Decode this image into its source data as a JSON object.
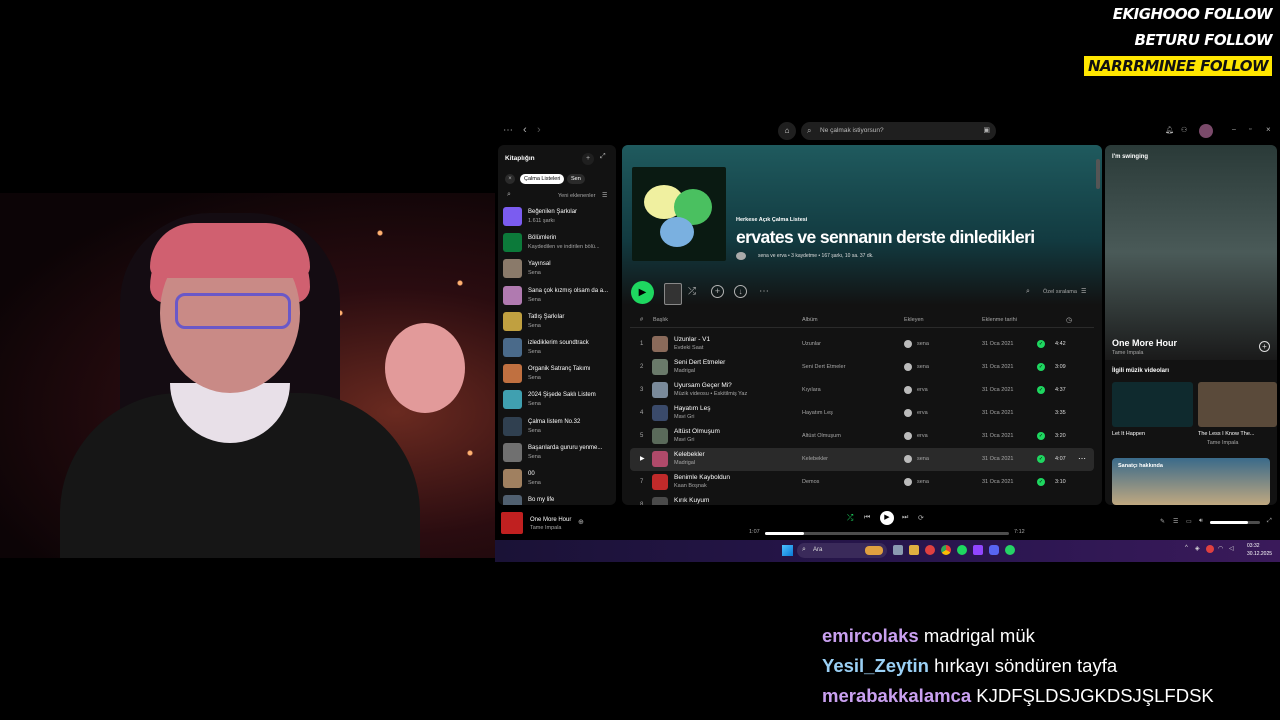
{
  "overlay": {
    "follows": [
      {
        "name": "EKIGHOOO",
        "action": "FOLLOW"
      },
      {
        "name": "BETURU",
        "action": "FOLLOW"
      },
      {
        "name": "NARRRMINEE",
        "action": "FOLLOW"
      }
    ]
  },
  "spotify": {
    "search_placeholder": "Ne çalmak istiyorsun?",
    "library": {
      "title": "Kitaplığın",
      "filters": [
        "Çalma Listeleri",
        "Sen"
      ],
      "sort_label": "Yeni eklenenler",
      "items": [
        {
          "title": "Beğenilen Şarkılar",
          "subtitle": "1.611 şarkı",
          "color": "#7b5cf0"
        },
        {
          "title": "Bölümlerin",
          "subtitle": "Kaydedilen ve indirilen bölü...",
          "color": "#0c7a3a"
        },
        {
          "title": "Yayınsal",
          "subtitle": "Sena",
          "color": "#8a7a6a"
        },
        {
          "title": "Sana çok kızmış olsam da a...",
          "subtitle": "Sena",
          "color": "#b07ab0"
        },
        {
          "title": "Tatlış Şarkılar",
          "subtitle": "Sena",
          "color": "#c0a040"
        },
        {
          "title": "izlediklerim soundtrack",
          "subtitle": "Sena",
          "color": "#4a6a8a"
        },
        {
          "title": "Organik Satranç Takımı",
          "subtitle": "Sena",
          "color": "#c07040"
        },
        {
          "title": "2024 Şişede Saklı Listem",
          "subtitle": "Sena",
          "color": "#40a0b0"
        },
        {
          "title": "Çalma listem No.32",
          "subtitle": "Sena",
          "color": "#304050"
        },
        {
          "title": "Başarılarda gururu yenme...",
          "subtitle": "Sena",
          "color": "#707070"
        },
        {
          "title": "00",
          "subtitle": "Sena",
          "color": "#a08060"
        },
        {
          "title": "Bo my life",
          "subtitle": "",
          "color": "#506070"
        }
      ]
    },
    "playlist": {
      "type_label": "Herkese Açık Çalma Listesi",
      "title": "ervates ve sennanın derste dinledikleri",
      "meta": "sena ve erva • 3 kaydetme • 167 şarkı, 10 sa. 37 dk.",
      "sort_label": "Özel sıralama",
      "columns": {
        "num": "#",
        "title": "Başlık",
        "album": "Albüm",
        "added_by": "Ekleyen",
        "date": "Eklenme tarihi"
      },
      "tracks": [
        {
          "num": "1",
          "title": "Uzunlar - V1",
          "artist": "Evdeki Saat",
          "album": "Uzunlar",
          "added_by": "sena",
          "date": "31 Oca 2021",
          "duration": "4:42",
          "saved": true,
          "color": "#8a6a5a"
        },
        {
          "num": "2",
          "title": "Seni Dert Etmeler",
          "artist": "Madrigal",
          "album": "Seni Dert Etmeler",
          "added_by": "sena",
          "date": "31 Oca 2021",
          "duration": "3:09",
          "saved": true,
          "color": "#6a7a6a"
        },
        {
          "num": "3",
          "title": "Uyursam Geçer Mi?",
          "artist": "Müzik videosu • Eskitilmiş Yaz",
          "album": "Kıyılara",
          "added_by": "erva",
          "date": "31 Oca 2021",
          "duration": "4:37",
          "saved": true,
          "color": "#7a8a9a"
        },
        {
          "num": "4",
          "title": "Hayatım Leş",
          "artist": "Mavi Gri",
          "album": "Hayatım Leş",
          "added_by": "erva",
          "date": "31 Oca 2021",
          "duration": "3:35",
          "saved": false,
          "color": "#3a4a6a"
        },
        {
          "num": "5",
          "title": "Altüst Olmuşum",
          "artist": "Mavi Gri",
          "album": "Altüst Olmuşum",
          "added_by": "erva",
          "date": "31 Oca 2021",
          "duration": "3:20",
          "saved": true,
          "color": "#5a6a5a"
        },
        {
          "num": "6",
          "title": "Kelebekler",
          "artist": "Madrigal",
          "album": "Kelebekler",
          "added_by": "sena",
          "date": "31 Oca 2021",
          "duration": "4:07",
          "saved": true,
          "color": "#b04a6a"
        },
        {
          "num": "7",
          "title": "Benimle Kayboldun",
          "artist": "Kaan Boşnak",
          "album": "Demos",
          "added_by": "sena",
          "date": "31 Oca 2021",
          "duration": "3:10",
          "saved": true,
          "color": "#c02a2a"
        },
        {
          "num": "8",
          "title": "Kırık Kuyum",
          "artist": "",
          "album": "",
          "added_by": "",
          "date": "",
          "duration": "",
          "saved": false,
          "color": "#4a4a4a"
        }
      ]
    },
    "now_playing_view": {
      "header": "I'm swinging",
      "track": "One More Hour",
      "artist": "Tame Impala",
      "videos_title": "İlgili müzik videoları",
      "videos": [
        {
          "title": "Let It Happen",
          "artist": ""
        },
        {
          "title": "The Less I Know The...",
          "artist": "Tame Impala"
        }
      ],
      "about_artist": "Sanatçı hakkında"
    },
    "player": {
      "track": "One More Hour",
      "artist": "Tame Impala",
      "elapsed": "1:07",
      "total": "7:12",
      "progress": 0.16,
      "volume": 0.75
    }
  },
  "taskbar": {
    "search_label": "Ara",
    "time": "03:32",
    "date": "30.12.2025"
  },
  "chat": [
    {
      "user": "emircolaks",
      "message": "madrigal mük",
      "color": "#c9a0f0"
    },
    {
      "user": "Yesil_Zeytin",
      "message": "hırkayı söndüren tayfa",
      "color": "#9ad0f5"
    },
    {
      "user": "merabakkalamca",
      "message": "KJDFŞLDSJGKDSJŞLFDSK",
      "color": "#c9a0f0"
    }
  ]
}
